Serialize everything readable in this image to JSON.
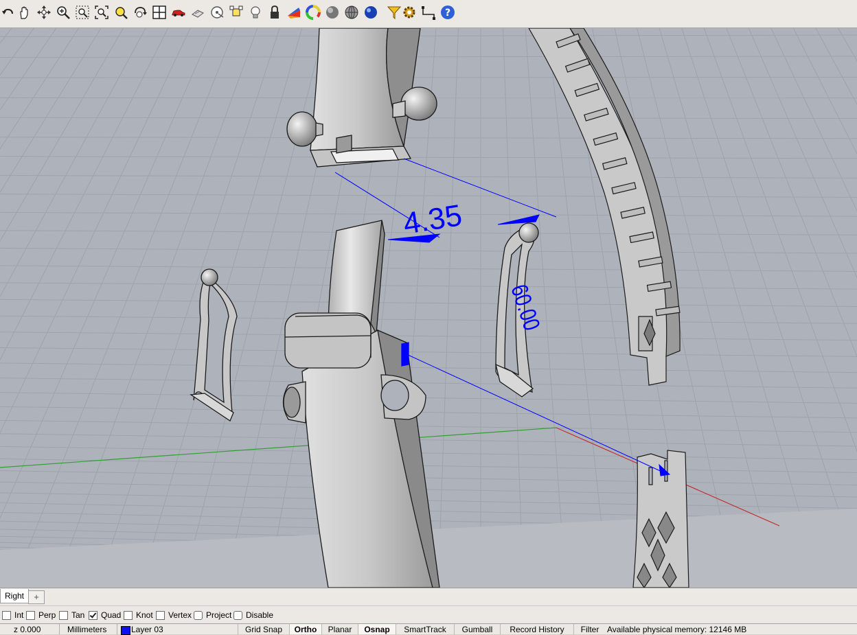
{
  "toolbar": {
    "icons": [
      "undo-arrow",
      "pan-hand",
      "rotate-view",
      "zoom-in",
      "zoom-window",
      "zoom-extents",
      "zoom-selected",
      "rotate-camera",
      "four-viewports",
      "car",
      "sunglasses-display",
      "target-circle",
      "snap-square",
      "lightbulb",
      "lock",
      "color-wedge",
      "color-wheel",
      "shaded-sphere",
      "ghosted-sphere",
      "rendered-sphere",
      "drape-funnel",
      "gear",
      "dimension-tool",
      "help"
    ]
  },
  "viewport": {
    "dimension_linear": "4.35",
    "dimension_angled": "60.00",
    "colors": {
      "background": "#aeb3bb",
      "grid": "#9ea3ab",
      "x_axis": "#c03030",
      "y_axis": "#30a030",
      "dimension": "#0000ff",
      "part": "#d0d0d0"
    }
  },
  "tabs": {
    "active": "Right",
    "add_label": "+"
  },
  "osnap": [
    {
      "label": "Int",
      "checked": false
    },
    {
      "label": "Perp",
      "checked": false
    },
    {
      "label": "Tan",
      "checked": false
    },
    {
      "label": "Quad",
      "checked": true
    },
    {
      "label": "Knot",
      "checked": false
    },
    {
      "label": "Vertex",
      "checked": false
    },
    {
      "label": "Project",
      "checked": false
    },
    {
      "label": "Disable",
      "checked": false
    }
  ],
  "status": {
    "coord": "z 0.000",
    "units": "Millimeters",
    "layer": "Layer 03",
    "layer_color": "#1010ee",
    "panes": [
      {
        "label": "Grid Snap",
        "on": false
      },
      {
        "label": "Ortho",
        "on": true
      },
      {
        "label": "Planar",
        "on": false
      },
      {
        "label": "Osnap",
        "on": true
      },
      {
        "label": "SmartTrack",
        "on": false
      },
      {
        "label": "Gumball",
        "on": false
      },
      {
        "label": "Record History",
        "on": false
      },
      {
        "label": "Filter",
        "on": false
      }
    ],
    "memory": "Available physical memory: 12146 MB"
  }
}
